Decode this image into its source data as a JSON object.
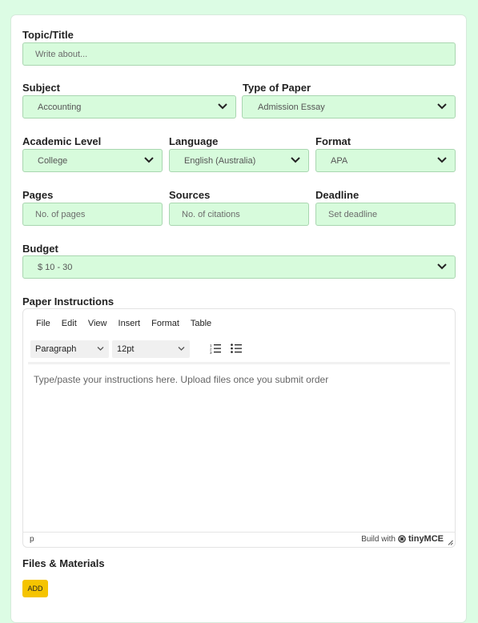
{
  "form": {
    "topic": {
      "label": "Topic/Title",
      "placeholder": "Write about..."
    },
    "subject": {
      "label": "Subject",
      "value": "Accounting"
    },
    "type_of_paper": {
      "label": "Type of Paper",
      "value": "Admission Essay"
    },
    "academic_level": {
      "label": "Academic Level",
      "value": "College"
    },
    "language": {
      "label": "Language",
      "value": "English (Australia)"
    },
    "format": {
      "label": "Format",
      "value": "APA"
    },
    "pages": {
      "label": "Pages",
      "placeholder": "No. of pages"
    },
    "sources": {
      "label": "Sources",
      "placeholder": "No. of citations"
    },
    "deadline": {
      "label": "Deadline",
      "placeholder": "Set deadline"
    },
    "budget": {
      "label": "Budget",
      "value": "$ 10 - 30"
    },
    "instructions": {
      "label": "Paper Instructions"
    },
    "files": {
      "label": "Files & Materials",
      "add_label": "ADD"
    }
  },
  "editor": {
    "menu": [
      "File",
      "Edit",
      "View",
      "Insert",
      "Format",
      "Table"
    ],
    "block_format": "Paragraph",
    "font_size": "12pt",
    "placeholder": "Type/paste your instructions here. Upload files once you submit order",
    "path": "p",
    "brand_prefix": "Build with",
    "brand_name": "tinyMCE"
  },
  "colors": {
    "page_bg": "#dcfce4",
    "field_bg": "#d7fbdc",
    "field_border": "#a9d6b0",
    "add_button": "#f5c400"
  },
  "icons": {
    "select_arrow": "chevron-down-icon",
    "numbered_list": "numbered-list-icon",
    "bulleted_list": "bulleted-list-icon",
    "tiny_logo": "tinymce-logo-icon",
    "resize": "resize-handle-icon"
  }
}
